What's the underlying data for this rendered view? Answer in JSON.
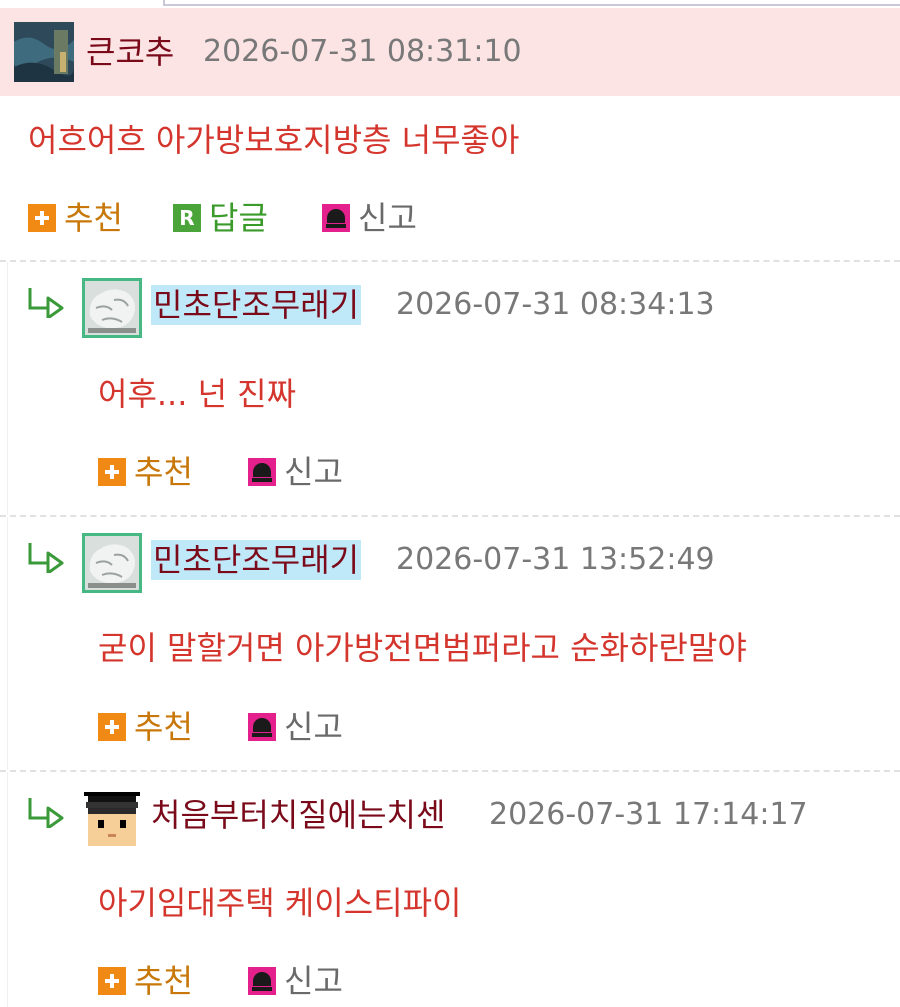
{
  "actions": {
    "recommend": "추천",
    "reply": "답글",
    "report": "신고",
    "reply_badge": "R"
  },
  "comments": [
    {
      "nickname": "큰코추",
      "time": "2026-07-31 08:31:10",
      "text": "어흐어흐 아가방보호지방층 너무좋아",
      "avatar_icon": "landscape-avatar-icon"
    },
    {
      "nickname": "민초단조무래기",
      "time": "2026-07-31 08:34:13",
      "text": "어후... 넌 진짜",
      "avatar_icon": "rock-avatar-icon"
    },
    {
      "nickname": "민초단조무래기",
      "time": "2026-07-31 13:52:49",
      "text": "굳이 말할거면 아가방전면범퍼라고 순화하란말야",
      "avatar_icon": "rock-avatar-icon"
    },
    {
      "nickname": "처음부터치질에는치센",
      "time": "2026-07-31 17:14:17",
      "text": "아기임대주택 케이스티파이",
      "avatar_icon": "pixel-face-avatar-icon"
    }
  ],
  "colors": {
    "header_highlight": "#fce4e4",
    "nickname": "#7a0a1a",
    "comment_text": "#d4352d",
    "recommend": "#f08a14",
    "reply": "#4aa43a",
    "report": "#e4208c"
  }
}
